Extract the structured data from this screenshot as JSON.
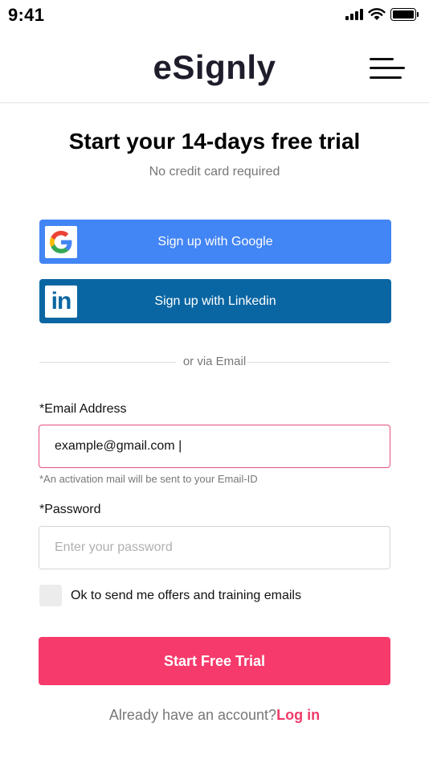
{
  "status_bar": {
    "time": "9:41"
  },
  "header": {
    "logo": "eSignly"
  },
  "main": {
    "title": "Start your 14-days free trial",
    "subtitle": "No credit card required",
    "google_button": "Sign up with Google",
    "linkedin_button": "Sign up with Linkedin",
    "linkedin_glyph": "in",
    "divider_text": "or via Email",
    "email_label": "*Email Address",
    "email_value": "example@gmail.com |",
    "email_hint": "*An activation mail will be sent to your Email-ID",
    "password_label": "*Password",
    "password_placeholder": "Enter your password",
    "offers_checkbox_label": "Ok to send me offers and training emails",
    "submit_button": "Start Free Trial",
    "footer_prompt": "Already have an account?",
    "login_link": "Log in"
  },
  "icons": [
    "signal-icon",
    "wifi-icon",
    "battery-icon",
    "hamburger-menu-icon",
    "google-icon",
    "linkedin-icon"
  ],
  "colors": {
    "google_blue": "#4285f4",
    "linkedin_blue": "#0a66a2",
    "accent_pink": "#f63b6c",
    "focus_border": "#e3507a",
    "logo_dark": "#1f1d2b"
  }
}
